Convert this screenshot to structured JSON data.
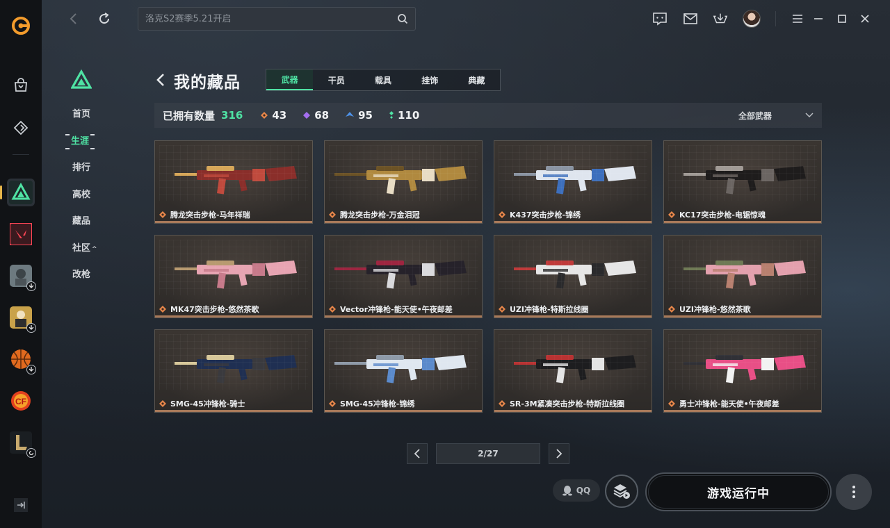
{
  "app": {
    "accent": "#4fe3a4",
    "search_placeholder": "洛克S2赛季5.21开启"
  },
  "rail": {
    "icons": [
      "app-logo-icon",
      "store-icon",
      "game-library-icon"
    ],
    "games": [
      {
        "name": "delta-force-icon",
        "active": true
      },
      {
        "name": "valorant-icon"
      },
      {
        "name": "pubg-mobile-icon",
        "download": true
      },
      {
        "name": "pubg-icon",
        "download": true
      },
      {
        "name": "nba-icon",
        "download": true
      },
      {
        "name": "crossfire-icon"
      },
      {
        "name": "league-of-legends-icon",
        "update": true
      }
    ]
  },
  "subnav": {
    "items": [
      {
        "label": "首页"
      },
      {
        "label": "生涯",
        "active": true
      },
      {
        "label": "排行"
      },
      {
        "label": "高校"
      },
      {
        "label": "藏品"
      },
      {
        "label": "社区",
        "caret": "^"
      },
      {
        "label": "改枪"
      }
    ]
  },
  "page": {
    "title": "我的藏品",
    "tabs": [
      {
        "label": "武器",
        "active": true
      },
      {
        "label": "干员"
      },
      {
        "label": "载具"
      },
      {
        "label": "挂饰"
      },
      {
        "label": "典藏"
      }
    ],
    "stats": {
      "label": "已拥有数量",
      "total": "316",
      "rarities": [
        {
          "count": "43",
          "color": "#e8874a"
        },
        {
          "count": "68",
          "color": "#a46ef0"
        },
        {
          "count": "95",
          "color": "#4e92e8"
        },
        {
          "count": "110",
          "color": "#4fe3a4"
        }
      ]
    },
    "filter_label": "全部武器",
    "items": [
      {
        "name": "腾龙突击步枪-马年祥瑞",
        "colors": [
          "#8a2e2a",
          "#c04a3d",
          "#d6a658"
        ]
      },
      {
        "name": "腾龙突击步枪-万金泪冠",
        "colors": [
          "#b0893f",
          "#e8dcc4",
          "#6b5225"
        ]
      },
      {
        "name": "K437突击步枪-锦绣",
        "colors": [
          "#dfe5ee",
          "#3d6fbd",
          "#8a94a2"
        ]
      },
      {
        "name": "KC17突击步枪-电锯惊魂",
        "colors": [
          "#1e1c1c",
          "#6b6562",
          "#a09a95"
        ]
      },
      {
        "name": "MK47突击步枪-悠然茶歌",
        "colors": [
          "#e7a4b2",
          "#c77a8a",
          "#b89a70"
        ]
      },
      {
        "name": "Vector冲锋枪-能天使•午夜邮差",
        "colors": [
          "#26222a",
          "#d9d9dc",
          "#9e2540"
        ]
      },
      {
        "name": "UZI冲锋枪-特斯拉线圈",
        "colors": [
          "#e6e6e6",
          "#2a2a2c",
          "#c03a3a"
        ]
      },
      {
        "name": "UZI冲锋枪-悠然茶歌",
        "colors": [
          "#e3a0ad",
          "#b8806f",
          "#6f7a55"
        ]
      },
      {
        "name": "SMG-45冲锋枪-骑士",
        "colors": [
          "#1f2f52",
          "#3a3a3e",
          "#d8c89a"
        ]
      },
      {
        "name": "SMG-45冲锋枪-锦绣",
        "colors": [
          "#dfe7f0",
          "#5b8acb",
          "#8e9aa8"
        ]
      },
      {
        "name": "SR-3M紧凑突击步枪-特斯拉线圈",
        "colors": [
          "#1d1d1f",
          "#e4e4e4",
          "#b83232"
        ]
      },
      {
        "name": "勇士冲锋枪-能天使•午夜邮差",
        "colors": [
          "#e84f86",
          "#f2f2f2",
          "#303036"
        ]
      }
    ],
    "pagination": {
      "text": "2/27"
    }
  },
  "bottom": {
    "qq_label": "QQ",
    "play_label": "游戏运行中"
  }
}
